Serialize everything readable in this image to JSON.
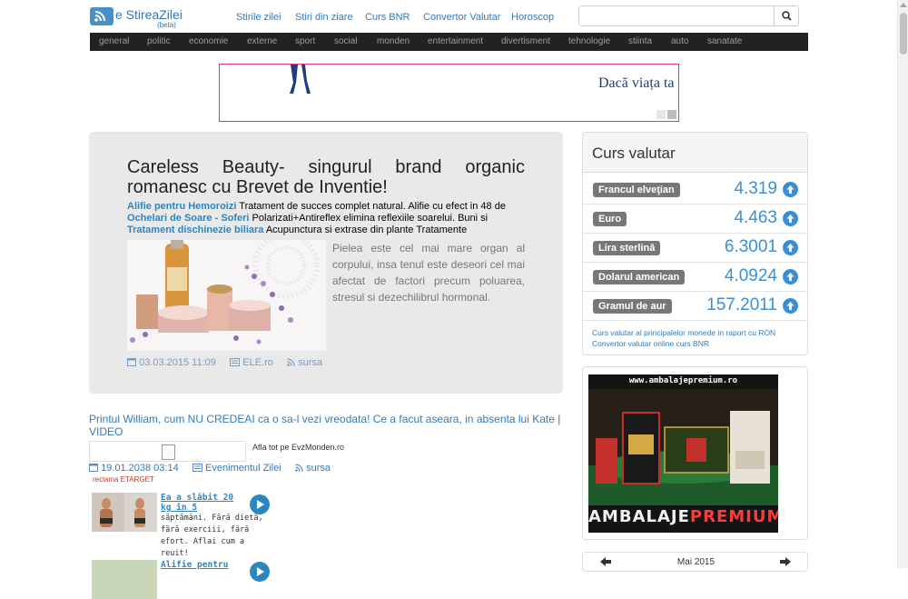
{
  "site": {
    "name": "e StireaZilei",
    "beta": "(beta)"
  },
  "topnav": [
    "Stirile zilei",
    "Stiri din ziare",
    "Curs BNR",
    "Convertor Valutar",
    "Horoscop"
  ],
  "search": {
    "placeholder": "",
    "value": ""
  },
  "categories": [
    "general",
    "politic",
    "economie",
    "externe",
    "sport",
    "social",
    "monden",
    "entertainment",
    "divertisment",
    "tehnologie",
    "stiinta",
    "auto",
    "sanatate"
  ],
  "banner": {
    "text": "Dacă viața ta"
  },
  "featured": {
    "title_line1": "Careless Beauty- singurul brand organic",
    "title_line2": "romanesc cu Brevet de Inventie!",
    "ads": [
      {
        "link": "Alifie pentru Hemoroizi",
        "text": " Tratament de succes complet natural. Alifie cu efect in 48 de"
      },
      {
        "link": "Ochelari de Soare - Soferi",
        "text": " Polarizati+Antireflex elimina reflexiile soarelui. Buni si"
      },
      {
        "link": "Tratament dischinezie biliara",
        "text": " Acupunctura si extrase din plante Tratamente"
      }
    ],
    "excerpt": "Pielea este cel mai mare organ al corpului, insa tenul este deseori cel mai afectat de factori precum poluarea, stresul si dezechilibrul hormonal.",
    "date": "03.03.2015 11:09",
    "source": "ELE.ro",
    "sursa": "sursa"
  },
  "story2": {
    "title": "Printul William, cum NU CREDEAI ca o sa-l vezi vreodata! Ce a facut aseara, in absenta lui Kate | VIDEO",
    "embed_label": "Afla tot pe EvzMonden.ro",
    "date": "19.01.2038 03:14",
    "source": "Evenimentul Zilei",
    "sursa": "sursa",
    "reclama": "reclama ETARGET"
  },
  "promos": [
    {
      "title": "Ea a slăbit 20 kg în 5",
      "desc": "săptămâni. Fără dietă, fără exerciii, fără efort. Aflai cum a reuit!"
    },
    {
      "title": "Alifie pentru",
      "desc": ""
    }
  ],
  "curs": {
    "heading": "Curs valutar",
    "rates": [
      {
        "name": "Francul elveţian",
        "value": "4.319"
      },
      {
        "name": "Euro",
        "value": "4.463"
      },
      {
        "name": "Lira sterlină",
        "value": "6.3001"
      },
      {
        "name": "Dolarul american",
        "value": "4.0924"
      },
      {
        "name": "Gramul de aur",
        "value": "157.2011"
      }
    ],
    "link1": "Curs valutar al principalelor monede in raport cu RON",
    "link2": "Convertor valutar online curs BNR"
  },
  "ad": {
    "url": "www.ambalajepremium.ro",
    "brand_a": "AMBALAJE",
    "brand_b": "PREMIUM"
  },
  "calendar": {
    "month": "Mai 2015"
  },
  "colors": {
    "accent": "#337ab7",
    "catbar": "#222222",
    "badge": "#777777",
    "rate": "#3a8fd8",
    "banner_border": "#e23878"
  }
}
